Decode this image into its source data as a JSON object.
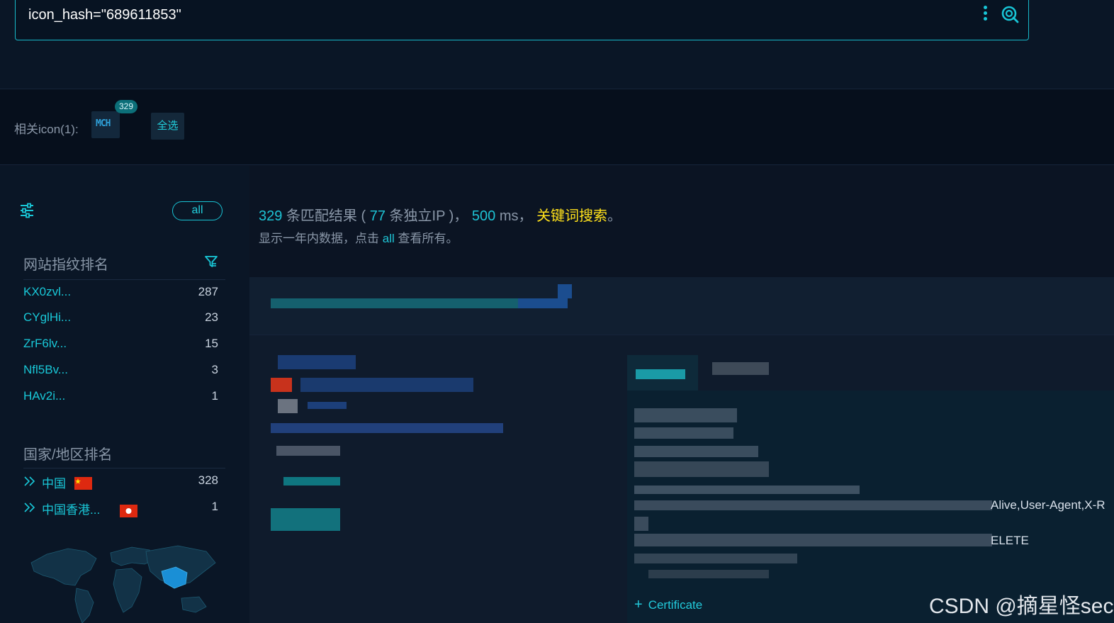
{
  "search": {
    "query": "icon_hash=\"689611853\""
  },
  "related_icons": {
    "label": "相关icon(1):",
    "icon_count": "329",
    "icon_logo_text": "MCH",
    "select_all": "全选"
  },
  "sidebar": {
    "all_label": "all",
    "fingerprint_title": "网站指纹排名",
    "fingerprints": [
      {
        "name": "KX0zvl...",
        "count": "287"
      },
      {
        "name": "CYglHi...",
        "count": "23"
      },
      {
        "name": "ZrF6lv...",
        "count": "15"
      },
      {
        "name": "Nfl5Bv...",
        "count": "3"
      },
      {
        "name": "HAv2i...",
        "count": "1"
      }
    ],
    "country_title": "国家/地区排名",
    "countries": [
      {
        "name": "中国",
        "count": "328",
        "flag": "flag-cn"
      },
      {
        "name": "中国香港...",
        "count": "1",
        "flag": "flag-hk"
      }
    ]
  },
  "results": {
    "total": "329",
    "total_suffix": "条匹配结果",
    "paren_open": "(",
    "unique_ip": "77",
    "unique_ip_suffix": "条独立IP",
    "paren_close": ")，",
    "time_value": "500",
    "time_unit": "ms，",
    "keyword_search": "关键词搜索",
    "period": "。",
    "hint_prefix": "显示一年内数据，点击",
    "hint_link": "all",
    "hint_suffix": "查看所有。"
  },
  "card": {
    "partial_text_1": "Alive,User-Agent,X-R",
    "partial_text_2": "ELETE",
    "cert_plus": "+",
    "cert_label": "Certificate"
  },
  "watermark": "CSDN @摘星怪sec",
  "colors": {
    "accent": "#19c8d8",
    "keyword": "#ffe11b",
    "background": "#0b1423"
  }
}
